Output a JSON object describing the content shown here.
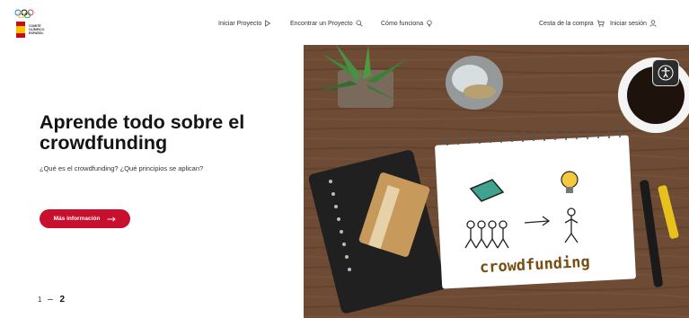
{
  "header": {
    "logo_text": "COMITÉ OLÍMPICO ESPAÑOL",
    "nav": [
      {
        "label": "Iniciar Proyecto",
        "icon": "play-outline-icon"
      },
      {
        "label": "Encontrar un Proyecto",
        "icon": "search-icon"
      },
      {
        "label": "Cómo funciona",
        "icon": "lightbulb-icon"
      }
    ],
    "cart_label": "Cesta de la compra",
    "login_label": "Iniciar sesión"
  },
  "hero": {
    "title": "Aprende todo sobre el crowdfunding",
    "subtitle": "¿Qué es el crowdfunding? ¿Qué principios se aplican?",
    "cta_label": "Más información",
    "cta_icon": "arrow-right-icon",
    "image_text": "crowdfunding"
  },
  "pager": {
    "first": "1",
    "current": "2"
  },
  "accessibility": {
    "icon": "accessibility-icon"
  },
  "colors": {
    "accent": "#c8102e",
    "text": "#1a1a1a",
    "wood": "#6b4a33"
  }
}
